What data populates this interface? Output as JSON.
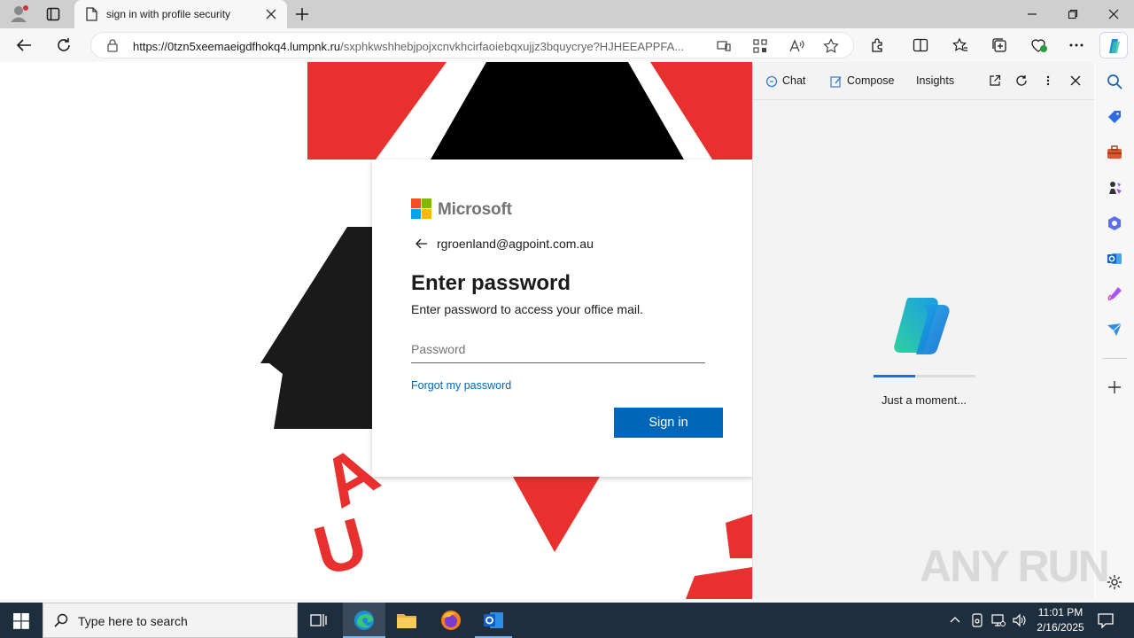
{
  "browser": {
    "tab_title": "sign in with profile security",
    "url_host": "https://0tzn5xeemaeigdfhokq4.lumpnk.ru",
    "url_path": "/sxphkwshhebjpojxcnvkhcirfaoiebqxujjz3bquycrye?HJHEEAPPFA..."
  },
  "signin": {
    "brand": "Microsoft",
    "identity": "rgroenland@agpoint.com.au",
    "title": "Enter password",
    "subtitle": "Enter password to access your office mail.",
    "password_placeholder": "Password",
    "forgot_label": "Forgot my password",
    "signin_label": "Sign in"
  },
  "background_letters": [
    "A",
    "U"
  ],
  "copilot": {
    "tabs": [
      "Chat",
      "Compose",
      "Insights"
    ],
    "loading_text": "Just a moment..."
  },
  "taskbar": {
    "search_placeholder": "Type here to search",
    "time": "11:01 PM",
    "date": "2/16/2025"
  },
  "watermark": "ANY RUN",
  "colors": {
    "accent": "#0067b8",
    "logo_red": "#f25022",
    "logo_green": "#7fba00",
    "logo_blue": "#00a4ef",
    "logo_yellow": "#ffb900",
    "bg_red": "#e8312f"
  }
}
